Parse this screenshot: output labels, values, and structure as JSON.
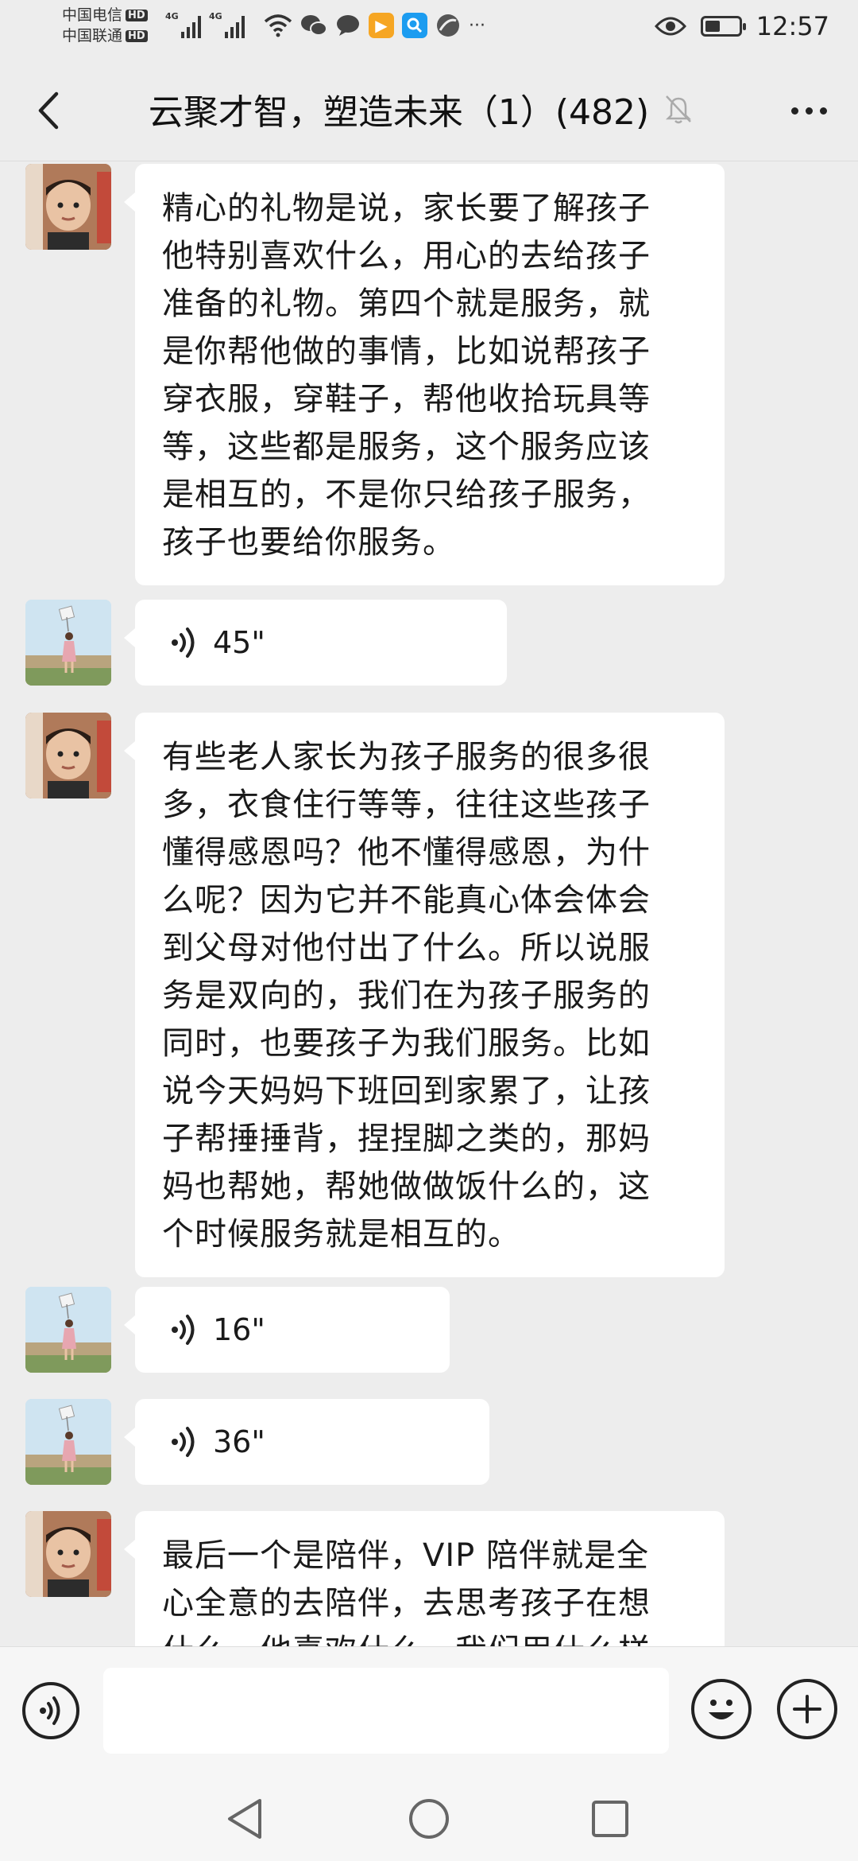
{
  "status_bar": {
    "carrier_1": "中国电信",
    "carrier_2": "中国联通",
    "hd_label": "HD",
    "network_type": "4G",
    "more_indicator": "···",
    "time": "12:57",
    "battery_level": 0.45,
    "icons": [
      "signal-icon",
      "wifi-icon",
      "wechat-icon",
      "message-icon",
      "video-app-icon",
      "search-app-icon",
      "browser-icon",
      "eye-icon",
      "battery-icon"
    ]
  },
  "header": {
    "title": "云聚才智，塑造未来（1）(482)",
    "back_icon": "chevron-left-icon",
    "mute_icon": "bell-off-icon",
    "more_icon": "more-dots-icon"
  },
  "messages": [
    {
      "type": "text",
      "avatar": "boy-avatar",
      "text": "精心的礼物是说，家长要了解孩子\n他特别喜欢什么，用心的去给孩子\n准备的礼物。第四个就是服务，就\n是你帮他做的事情，比如说帮孩子\n穿衣服，穿鞋子，帮他收拾玩具等\n等，这些都是服务，这个服务应该\n是相互的，不是你只给孩子服务，\n孩子也要给你服务。"
    },
    {
      "type": "voice",
      "avatar": "girl-avatar",
      "duration": "45\""
    },
    {
      "type": "text",
      "avatar": "boy-avatar",
      "text": "有些老人家长为孩子服务的很多很\n多，衣食住行等等，往往这些孩子\n懂得感恩吗？他不懂得感恩，为什\n么呢？因为它并不能真心体会体会\n到父母对他付出了什么。所以说服\n务是双向的，我们在为孩子服务的\n同时，也要孩子为我们服务。比如\n说今天妈妈下班回到家累了，让孩\n子帮捶捶背，捏捏脚之类的，那妈\n妈也帮她，帮她做做饭什么的，这\n个时候服务就是相互的。"
    },
    {
      "type": "voice",
      "avatar": "girl-avatar",
      "duration": "16\""
    },
    {
      "type": "voice",
      "avatar": "girl-avatar",
      "duration": "36\""
    },
    {
      "type": "text",
      "avatar": "boy-avatar",
      "text": "最后一个是陪伴，VIP 陪伴就是全\n心全意的去陪伴，去思考孩子在想\n什么，他喜欢什么，我们用什么样"
    }
  ],
  "input_bar": {
    "placeholder": "",
    "voice_icon": "voice-toggle-icon",
    "emoji_icon": "emoji-icon",
    "plus_icon": "plus-icon"
  },
  "nav_bar": {
    "icons": [
      "nav-back-icon",
      "nav-home-icon",
      "nav-recents-icon"
    ]
  },
  "colors": {
    "background": "#ededed",
    "bubble": "#ffffff",
    "text": "#1a1a1a"
  }
}
